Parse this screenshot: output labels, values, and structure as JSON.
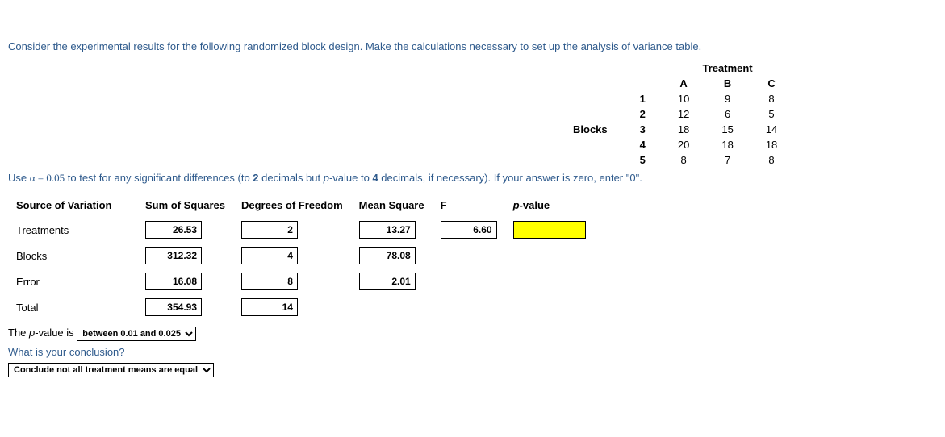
{
  "prompt1": "Consider the experimental results for the following randomized block design. Make the calculations necessary to set up the analysis of variance table.",
  "data": {
    "treatment_header": "Treatment",
    "cols": [
      "A",
      "B",
      "C"
    ],
    "blocks_label": "Blocks",
    "rows": [
      "1",
      "2",
      "3",
      "4",
      "5"
    ],
    "values": [
      [
        "10",
        "9",
        "8"
      ],
      [
        "12",
        "6",
        "5"
      ],
      [
        "18",
        "15",
        "14"
      ],
      [
        "20",
        "18",
        "18"
      ],
      [
        "8",
        "7",
        "8"
      ]
    ]
  },
  "prompt2_pre": "Use ",
  "alpha_expr": "α = 0.05",
  "prompt2_mid": " to test for any significant differences (to ",
  "two": "2",
  "prompt2_mid2": " decimals but ",
  "pval_it": "p",
  "prompt2_mid3": "-value to ",
  "four": "4",
  "prompt2_post": " decimals, if necessary). If your answer is zero, enter \"0\".",
  "anova": {
    "headers": [
      "Source of Variation",
      "Sum of Squares",
      "Degrees of Freedom",
      "Mean Square",
      "F",
      "p-value"
    ],
    "rows": {
      "treatments": {
        "label": "Treatments",
        "ss": "26.53",
        "df": "2",
        "ms": "13.27",
        "f": "6.60",
        "p": ""
      },
      "blocks": {
        "label": "Blocks",
        "ss": "312.32",
        "df": "4",
        "ms": "78.08"
      },
      "error": {
        "label": "Error",
        "ss": "16.08",
        "df": "8",
        "ms": "2.01"
      },
      "total": {
        "label": "Total",
        "ss": "354.93",
        "df": "14"
      }
    }
  },
  "pval_line_pre": "The ",
  "pval_line_mid": "-value is ",
  "pval_select": "between 0.01 and 0.025",
  "concl_q": "What is your conclusion?",
  "concl_select": "Conclude not all treatment means are equal"
}
